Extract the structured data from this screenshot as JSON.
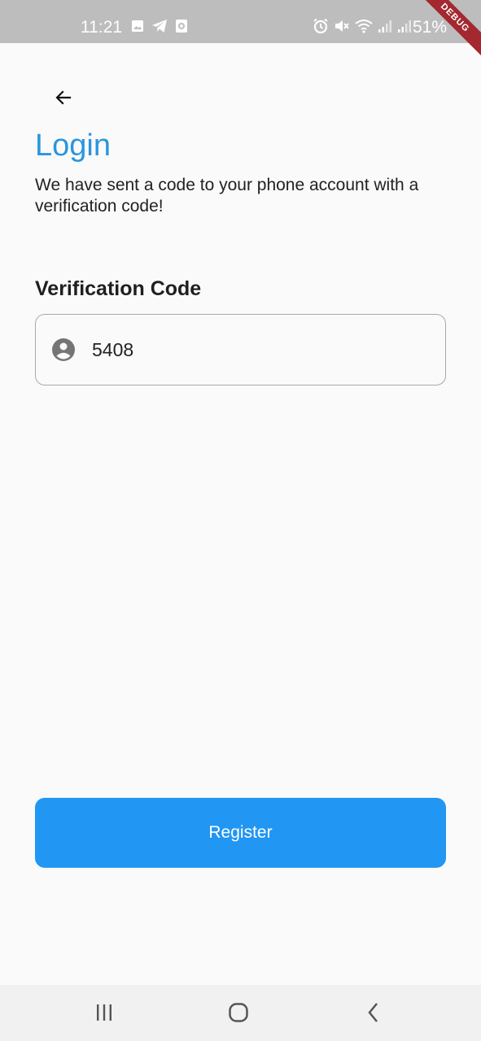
{
  "status_bar": {
    "time": "11:21",
    "battery": "51%",
    "debug_banner": "DEBUG",
    "left_icons": [
      "image-icon",
      "telegram-icon",
      "app-notification-icon"
    ],
    "right_icons": [
      "alarm-icon",
      "mute-icon",
      "wifi-icon",
      "signal-icon",
      "signal-icon",
      "battery-icon"
    ]
  },
  "header": {
    "back_icon": "arrow-left-icon",
    "title": "Login",
    "subtitle": "We have sent a code to your phone account with a verification code!"
  },
  "form": {
    "label": "Verification Code",
    "icon": "account-circle-icon",
    "value": "5408",
    "placeholder": ""
  },
  "actions": {
    "register_label": "Register"
  },
  "navigation": {
    "icons": [
      "recent-apps-icon",
      "home-icon",
      "back-icon"
    ]
  },
  "colors": {
    "title": "#2a95dd",
    "button": "#2196f3",
    "status_bar": "#bdbdbd",
    "background": "#fafafa"
  }
}
